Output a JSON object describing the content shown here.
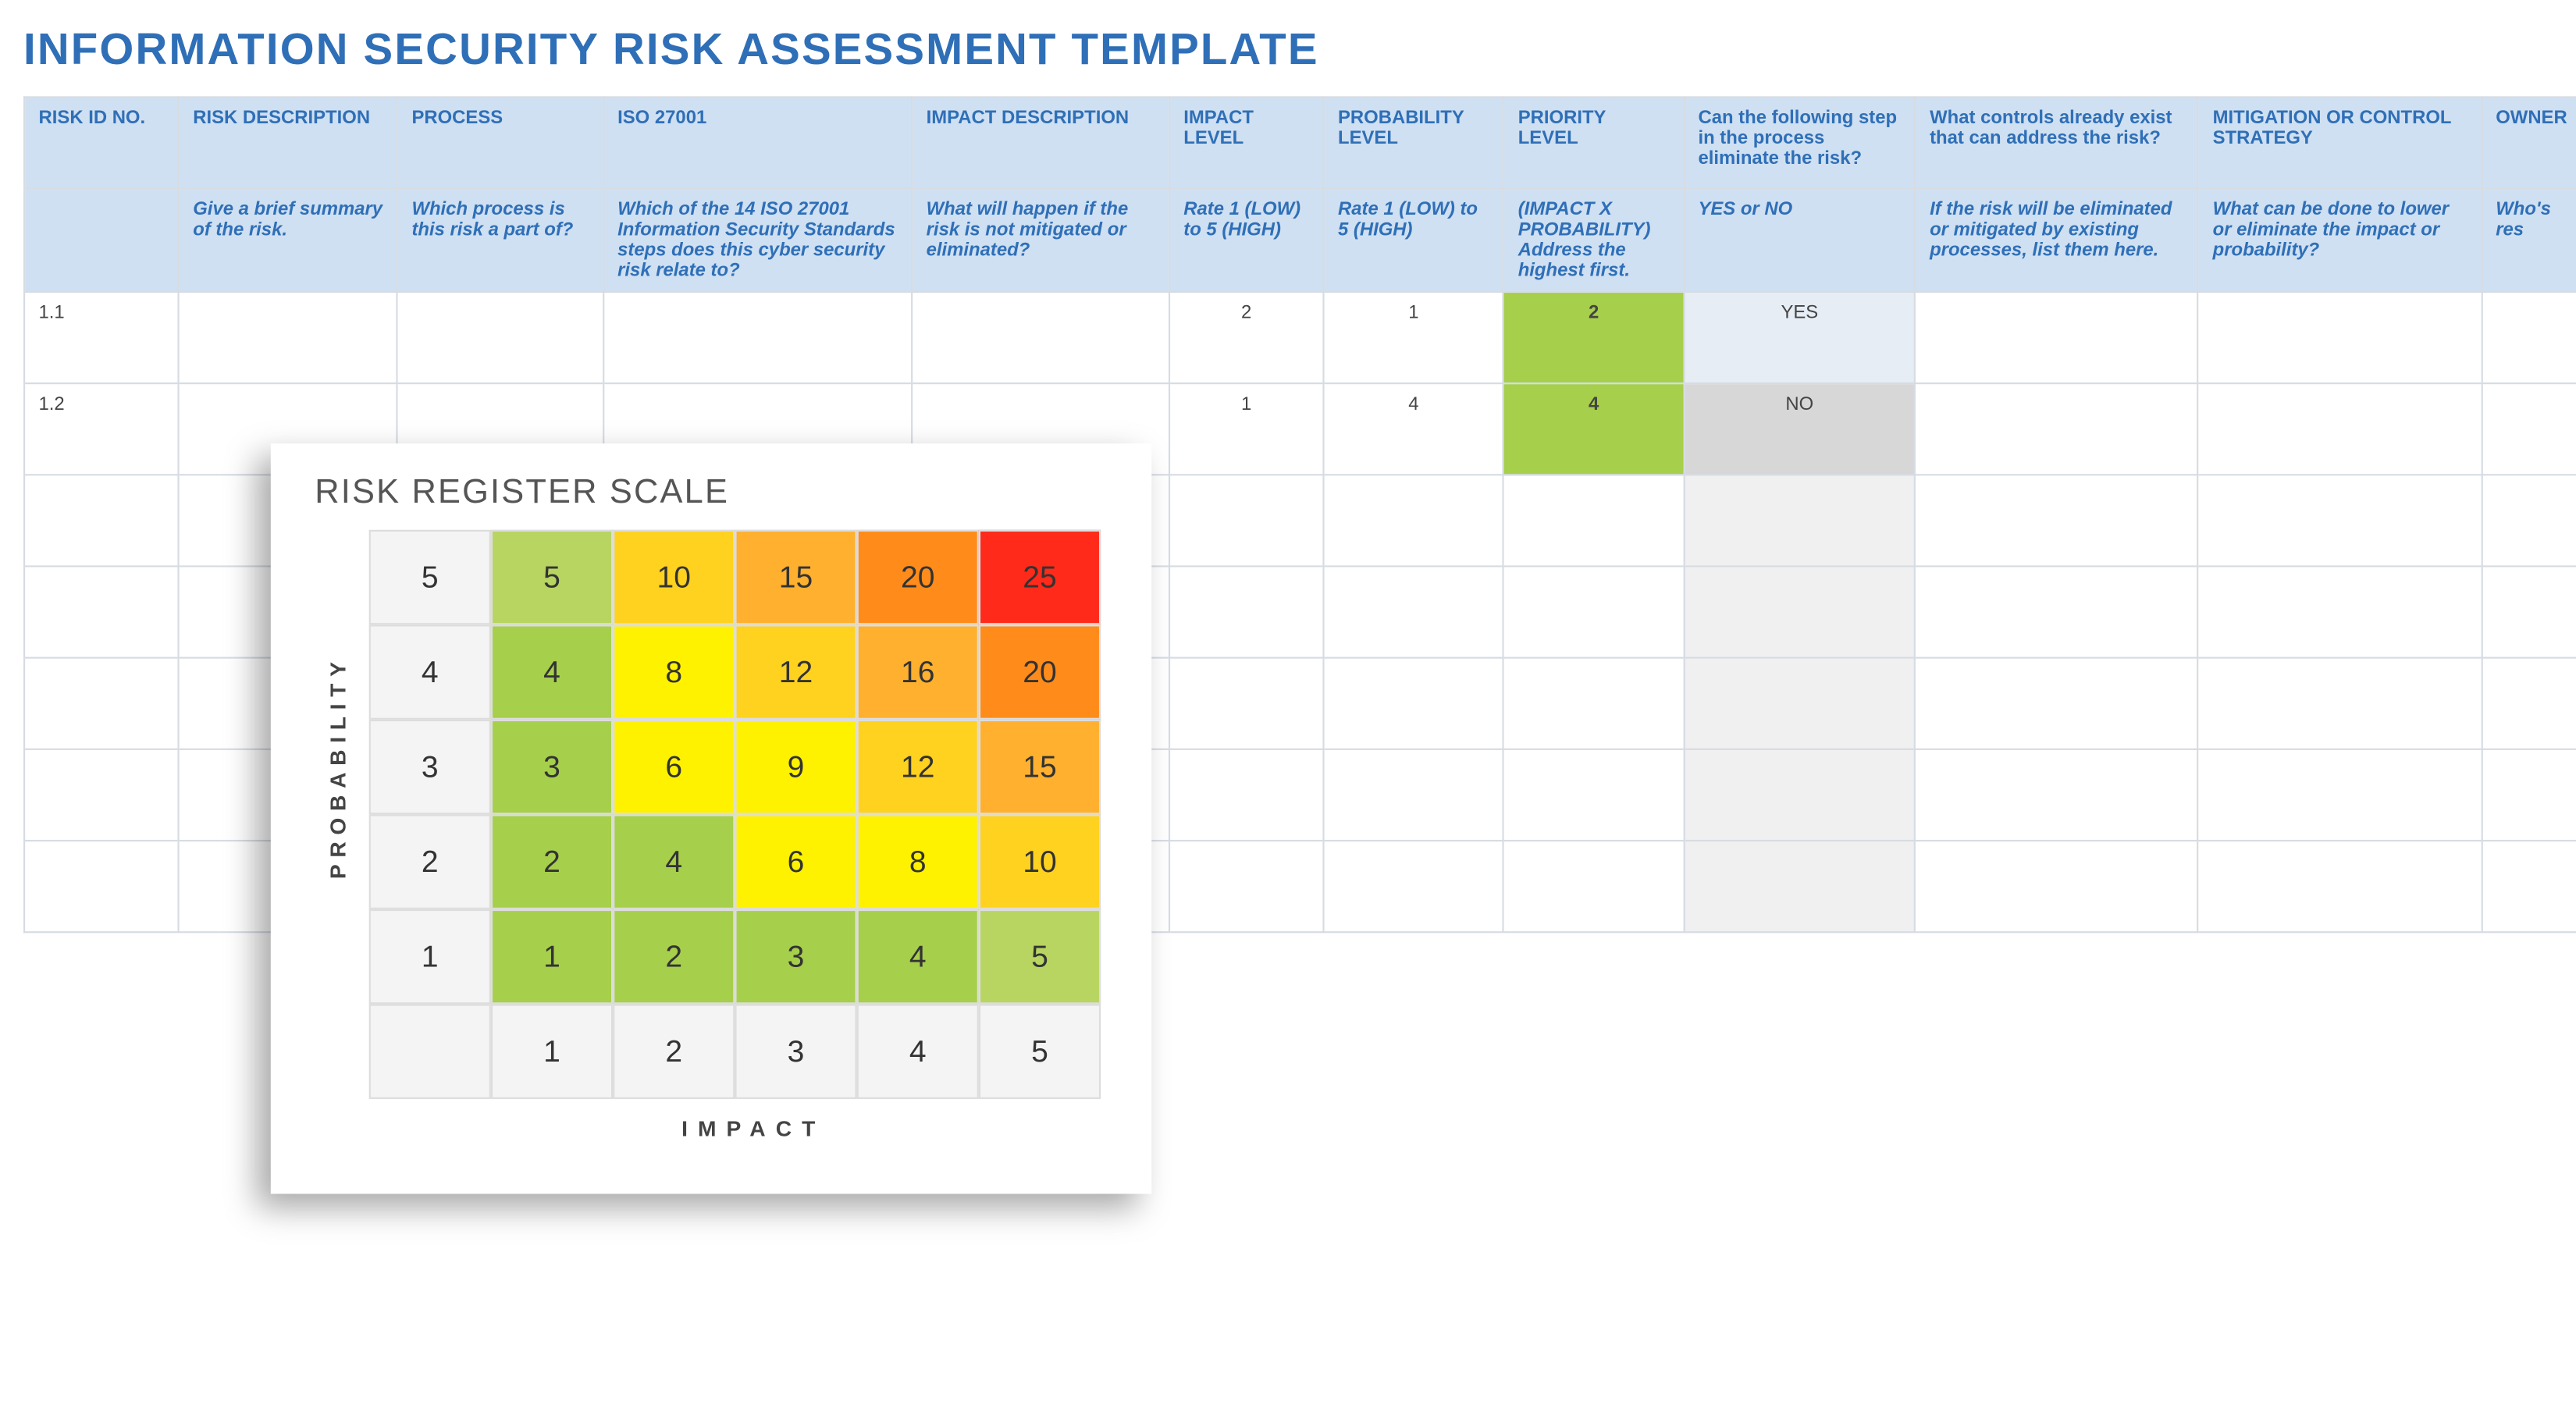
{
  "title": "INFORMATION SECURITY RISK ASSESSMENT TEMPLATE",
  "headers": {
    "id": "RISK ID NO.",
    "desc": "RISK DESCRIPTION",
    "proc": "PROCESS",
    "iso": "ISO 27001",
    "impd": "IMPACT DESCRIPTION",
    "il": "IMPACT LEVEL",
    "pl": "PROBABILITY LEVEL",
    "pr": "PRIORITY LEVEL",
    "elim": "Can the following step in the process eliminate the risk?",
    "exist": "What controls already exist that can address the risk?",
    "mit": "MITIGATION OR CONTROL STRATEGY",
    "own": "OWNER"
  },
  "sub": {
    "id": "",
    "desc": "Give a brief summary of the risk.",
    "proc": "Which process is this risk a part of?",
    "iso": "Which of the 14 ISO 27001 Information Security Standards steps does this cyber security risk relate to?",
    "impd": "What will happen if the risk is not mitigated or eliminated?",
    "il": "Rate 1 (LOW) to 5 (HIGH)",
    "pl": "Rate 1 (LOW) to 5 (HIGH)",
    "pr": "(IMPACT X PROBABILITY) Address the highest first.",
    "elim": "YES or NO",
    "exist": "If the risk will be eliminated or mitigated by existing processes, list them here.",
    "mit": "What can be done to lower or eliminate the impact or probability?",
    "own": "Who's res"
  },
  "rows": [
    {
      "id": "1.1",
      "il": "2",
      "pl": "1",
      "pr": "2",
      "elim": "YES"
    },
    {
      "id": "1.2",
      "il": "1",
      "pl": "4",
      "pr": "4",
      "elim": "NO"
    },
    {
      "id": "",
      "il": "",
      "pl": "",
      "pr": "",
      "elim": ""
    },
    {
      "id": "",
      "il": "",
      "pl": "",
      "pr": "",
      "elim": ""
    },
    {
      "id": "",
      "il": "",
      "pl": "",
      "pr": "",
      "elim": ""
    },
    {
      "id": "",
      "il": "",
      "pl": "",
      "pr": "",
      "elim": ""
    },
    {
      "id": "",
      "il": "",
      "pl": "",
      "pr": "",
      "elim": ""
    }
  ],
  "register": {
    "title": "RISK REGISTER SCALE",
    "xlabel": "IMPACT",
    "ylabel": "PROBABILITY"
  },
  "chart_data": {
    "type": "heatmap",
    "title": "RISK REGISTER SCALE",
    "xlabel": "IMPACT",
    "ylabel": "PROBABILITY",
    "x": [
      1,
      2,
      3,
      4,
      5
    ],
    "y": [
      1,
      2,
      3,
      4,
      5
    ],
    "values": [
      [
        1,
        2,
        3,
        4,
        5
      ],
      [
        2,
        4,
        6,
        8,
        10
      ],
      [
        3,
        6,
        9,
        12,
        15
      ],
      [
        4,
        8,
        12,
        16,
        20
      ],
      [
        5,
        10,
        15,
        20,
        25
      ]
    ],
    "color_scale": [
      {
        "max": 4,
        "color": "#a6cf4b"
      },
      {
        "max": 5,
        "color": "#b8d561"
      },
      {
        "max": 9,
        "color": "#fff200"
      },
      {
        "max": 12,
        "color": "#ffd21f"
      },
      {
        "max": 16,
        "color": "#ffb02e"
      },
      {
        "max": 20,
        "color": "#ff8c1a"
      },
      {
        "max": 25,
        "color": "#ff2a1a"
      }
    ]
  }
}
